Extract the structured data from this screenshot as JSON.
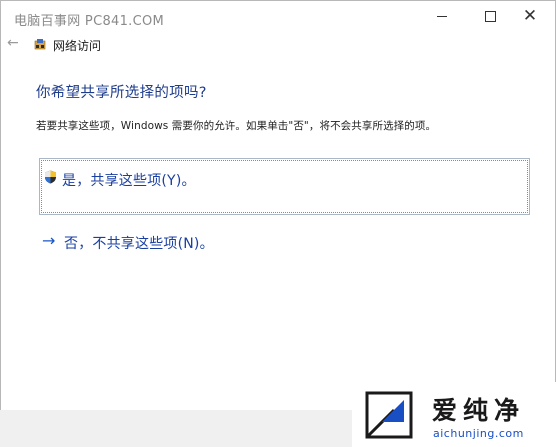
{
  "watermark": {
    "text": "电脑百事网 PC841.COM"
  },
  "nav": {
    "title": "网络访问"
  },
  "dialog": {
    "heading": "你希望共享所选择的项吗?",
    "description": "若要共享这些项，Windows 需要你的允许。如果单击\"否\"，将不会共享所选择的项。",
    "option_yes": "是，共享这些项(Y)。",
    "option_no": "否，不共享这些项(N)。"
  },
  "logo": {
    "text": "爱纯净",
    "url": "aichunjing.com"
  },
  "colors": {
    "link": "#1a3fa0",
    "heading": "#1e3c8c",
    "footer_bg": "#f0f0f0"
  },
  "icons": [
    "back-arrow-icon",
    "network-icon",
    "shield-icon",
    "arrow-right-icon",
    "minimize-icon",
    "maximize-icon",
    "close-icon"
  ]
}
